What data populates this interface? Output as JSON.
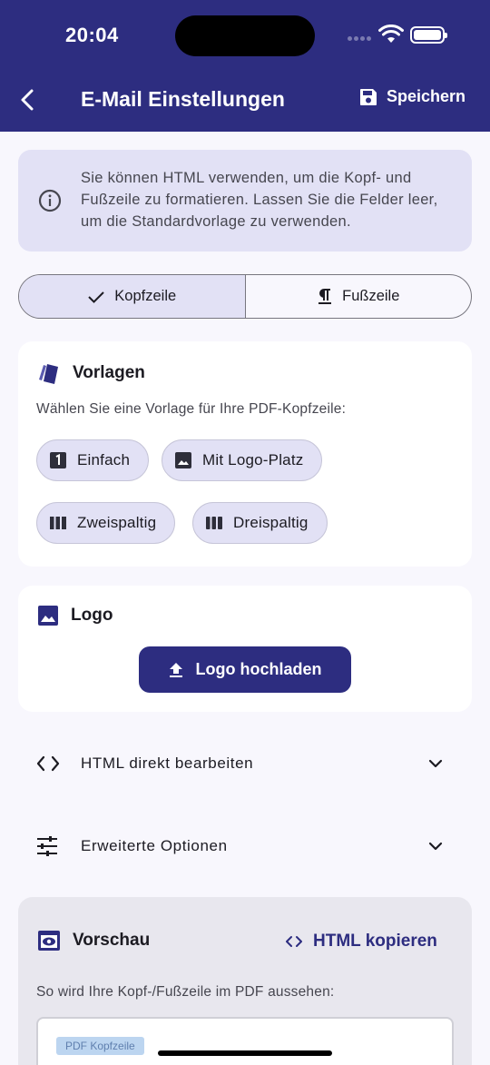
{
  "status_bar": {
    "time": "20:04"
  },
  "header": {
    "title": "E-Mail Einstellungen",
    "save_label": "Speichern"
  },
  "info": {
    "text": "Sie können HTML verwenden, um die Kopf- und Fußzeile zu formatieren. Lassen Sie die Felder leer, um die Standardvorlage zu verwenden."
  },
  "segmented": {
    "header_label": "Kopfzeile",
    "footer_label": "Fußzeile",
    "selected": "Kopfzeile"
  },
  "templates": {
    "title": "Vorlagen",
    "subtitle": "Wählen Sie eine Vorlage für Ihre PDF-Kopfzeile:",
    "chips": [
      "Einfach",
      "Mit Logo-Platz",
      "Zweispaltig",
      "Dreispaltig"
    ]
  },
  "logo": {
    "title": "Logo",
    "upload_label": "Logo hochladen"
  },
  "expanders": {
    "html_edit": "HTML direkt bearbeiten",
    "advanced": "Erweiterte Optionen"
  },
  "preview": {
    "title": "Vorschau",
    "copy_label": "HTML kopieren",
    "subtitle": "So wird Ihre Kopf-/Fußzeile im PDF aussehen:",
    "tag": "PDF Kopfzeile"
  },
  "colors": {
    "primary": "#2d2d80",
    "chip_bg": "#e2e1f5",
    "background": "#f8f7fd"
  }
}
